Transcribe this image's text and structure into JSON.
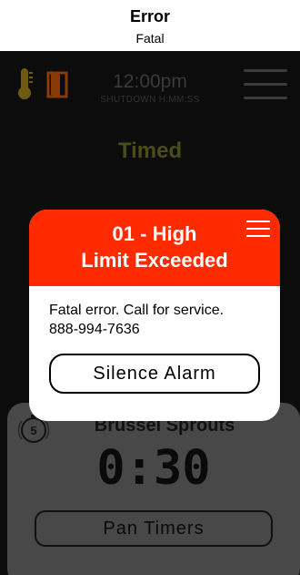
{
  "caption": {
    "title": "Error",
    "subtitle": "Fatal"
  },
  "status_bar": {
    "time": "12:00pm",
    "shutdown_label": "SHUTDOWN H:MM:SS",
    "icons": [
      "thermometer-icon",
      "door-icon",
      "hamburger-menu-icon"
    ]
  },
  "mode_label": "Timed",
  "card": {
    "product_name": "Brussel Sprouts",
    "timer_badge": "5",
    "timer_value": "0:30",
    "pan_timers_label": "Pan Timers"
  },
  "modal": {
    "title_line1": "01 - High",
    "title_line2": "Limit Exceeded",
    "message_line1": "Fatal error. Call for service.",
    "message_line2": "888-994-7636",
    "silence_label": "Silence Alarm"
  },
  "colors": {
    "alert_red": "#ff2a00",
    "thermometer": "#6f5a12",
    "door": "#8a3a06",
    "timed_text": "#4a4d1a",
    "card_bg": "#484848"
  }
}
